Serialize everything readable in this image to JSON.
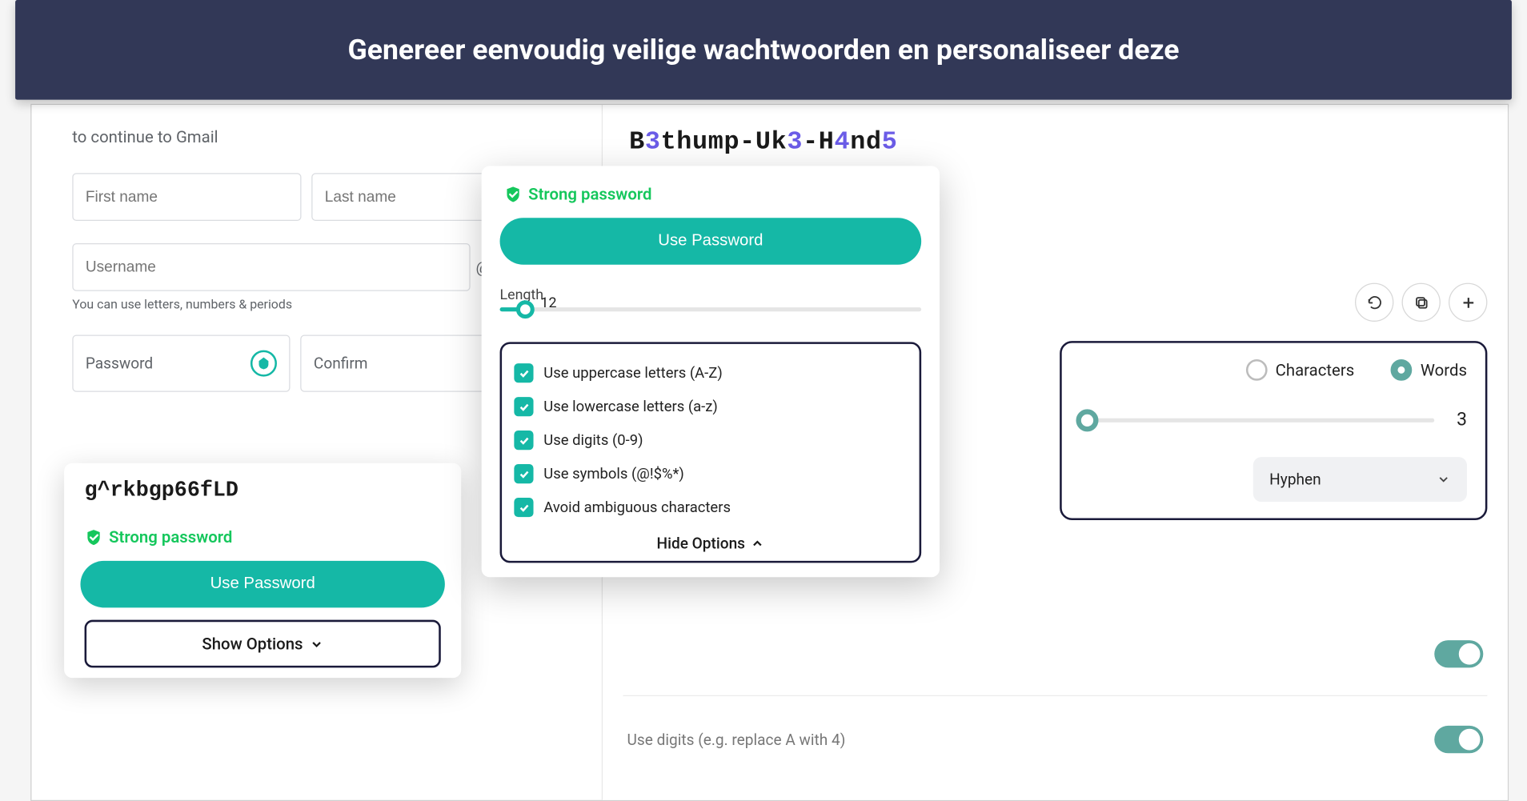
{
  "banner": {
    "text": "Genereer eenvoudig veilige wachtwoorden en personaliseer deze"
  },
  "google_form": {
    "continue_text": "to continue to Gmail",
    "first_name_placeholder": "First name",
    "last_name_placeholder": "Last name",
    "username_placeholder": "Username",
    "at_symbol": "@",
    "helper_text": "You can use letters, numbers & periods",
    "password_placeholder": "Password",
    "confirm_placeholder": "Confirm"
  },
  "popup_small": {
    "generated_password": "g^rkbgp66fLD",
    "strength_label": "Strong password",
    "use_password_label": "Use Password",
    "show_options_label": "Show Options"
  },
  "popup_large": {
    "strength_label": "Strong password",
    "use_password_label": "Use Password",
    "length_label": "Length",
    "length_value": "12",
    "options": [
      "Use uppercase letters (A-Z)",
      "Use lowercase letters (a-z)",
      "Use digits (0-9)",
      "Use symbols (@!$%*)",
      "Avoid ambiguous characters"
    ],
    "hide_options_label": "Hide Options"
  },
  "right_panel": {
    "passphrase_segments": [
      {
        "t": "B",
        "c": "norm"
      },
      {
        "t": "3",
        "c": "num"
      },
      {
        "t": "thump-Uk",
        "c": "norm"
      },
      {
        "t": "3",
        "c": "num"
      },
      {
        "t": "-H",
        "c": "norm"
      },
      {
        "t": "4",
        "c": "num"
      },
      {
        "t": "nd",
        "c": "norm"
      },
      {
        "t": "5",
        "c": "num"
      }
    ],
    "radio_characters_label": "Characters",
    "radio_words_label": "Words",
    "word_count": "3",
    "separator_label": "Hyphen",
    "toggle2_label": "Use digits (e.g. replace A with 4)"
  },
  "icons": {
    "refresh": "refresh-icon",
    "copy": "copy-icon",
    "plus": "plus-icon"
  }
}
